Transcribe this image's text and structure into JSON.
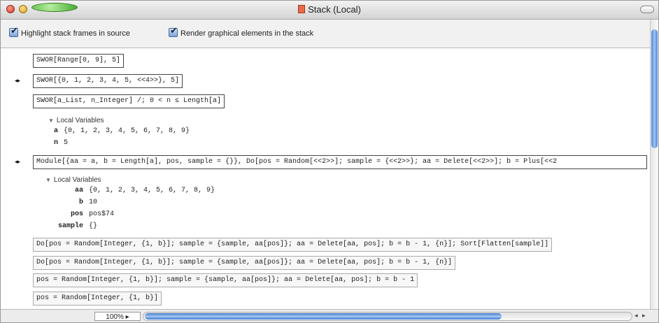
{
  "window": {
    "title": "Stack (Local)"
  },
  "options": {
    "highlight_label": "Highlight stack frames in source",
    "render_label": "Render graphical elements in the stack"
  },
  "frames": [
    "SWOR[Range[0, 9], 5]",
    "SWOR[{0, 1, 2, 3, 4, 5, <<4>>}, 5]",
    "SWOR[a_List, n_Integer] /; 0 < n ≤ Length[a]",
    "Module[{aa = a, b = Length[a], pos, sample = {}}, Do[pos = Random[<<2>>]; sample = {<<2>>}; aa = Delete[<<2>>]; b = Plus[<<2",
    "Do[pos = Random[Integer, {1, b}]; sample = {sample, aa[pos]}; aa = Delete[aa, pos]; b = b - 1, {n}]; Sort[Flatten[sample]]",
    "Do[pos = Random[Integer, {1, b}]; sample = {sample, aa[pos]}; aa = Delete[aa, pos]; b = b - 1, {n}]",
    "pos = Random[Integer, {1, b}]; sample = {sample, aa[pos]}; aa = Delete[aa, pos]; b = b - 1",
    "pos = Random[Integer, {1, b}]"
  ],
  "frame_arrows": [
    "◂▸",
    "◂▸"
  ],
  "local_vars_1": {
    "header": "Local Variables",
    "vars": [
      {
        "name": "a",
        "value": "{0, 1, 2, 3, 4, 5, 6, 7, 8, 9}"
      },
      {
        "name": "n",
        "value": "5"
      }
    ]
  },
  "local_vars_2": {
    "header": "Local Variables",
    "vars": [
      {
        "name": "aa",
        "value": "{0, 1, 2, 3, 4, 5, 6, 7, 8, 9}"
      },
      {
        "name": "b",
        "value": "10"
      },
      {
        "name": "pos",
        "value": "pos$74"
      },
      {
        "name": "sample",
        "value": "{}"
      }
    ]
  },
  "statusbar": {
    "zoom": "100%"
  },
  "scroll_arrows": "◂ ▸",
  "icons": [
    "close-light",
    "minimize-light",
    "zoom-light",
    "document-icon",
    "checkbox-checked-icon",
    "disclosure-triangle-icon",
    "frame-arrow-icon"
  ]
}
